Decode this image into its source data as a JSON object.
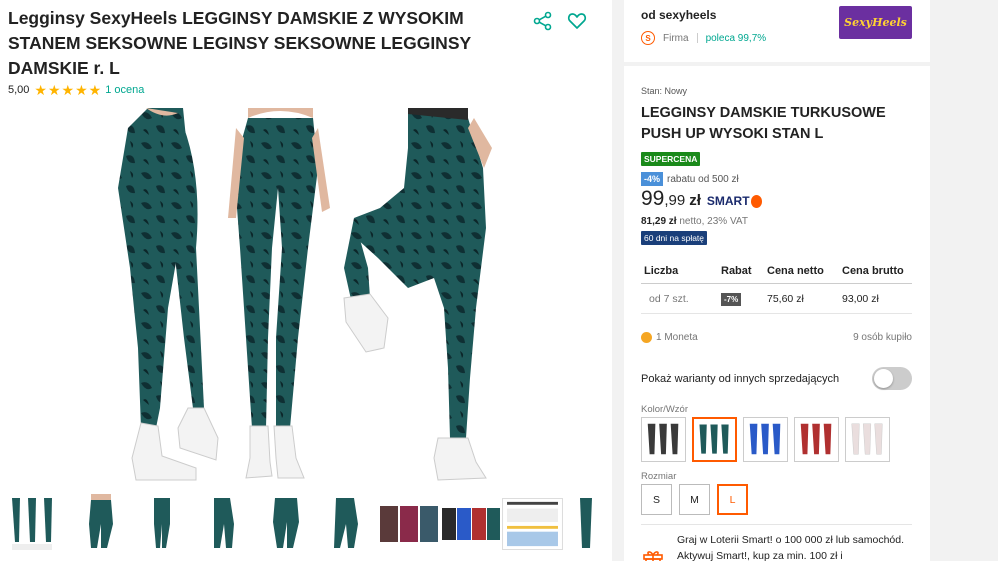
{
  "product": {
    "title": "Legginsy SexyHeels LEGGINSY DAMSKIE Z WYSOKIM STANEM SEKSOWNE LEGINSY SEKSOWNE LEGGINSY DAMSKIE r. L",
    "rating_value": "5,00",
    "rating_count": "1 ocena",
    "stars": 5
  },
  "icons": {
    "share": "share-icon",
    "favorite": "heart-icon"
  },
  "thumbnails": [
    {
      "name": "three-poses"
    },
    {
      "name": "back-view"
    },
    {
      "name": "front-view"
    },
    {
      "name": "side-view"
    },
    {
      "name": "back-pose"
    },
    {
      "name": "side-pose"
    },
    {
      "name": "color-grid"
    },
    {
      "name": "multi-color"
    },
    {
      "name": "size-chart"
    },
    {
      "name": "partial"
    }
  ],
  "seller": {
    "name": "od sexyheels",
    "type": "Firma",
    "recommend": "poleca 99,7%",
    "logo_text": "SexyHeels"
  },
  "offer": {
    "condition": "Stan: Nowy",
    "title": "LEGGINSY DAMSKIE TURKUSOWE PUSH UP WYSOKI STAN L",
    "super_badge": "SUPERCENA",
    "discount_pct": "-4%",
    "discount_text": "rabatu od 500 zł",
    "price_main": "99",
    "price_cents": ",99",
    "currency": "zł",
    "smart_label": "SMART",
    "netto_value": "81,29 zł",
    "netto_text": "netto, 23% VAT",
    "pay_later": "60 dni na spłatę"
  },
  "price_table": {
    "headers": [
      "Liczba",
      "Rabat",
      "Cena netto",
      "Cena brutto"
    ],
    "rows": [
      {
        "qty": "od 7 szt.",
        "rabat": "-7%",
        "netto": "75,60 zł",
        "brutto": "93,00 zł"
      }
    ]
  },
  "coins": {
    "label": "1 Moneta",
    "bought": "9 osób kupiło"
  },
  "other_sellers": {
    "label": "Pokaż warianty od innych sprzedających",
    "enabled": false
  },
  "variants": {
    "label": "Kolor/Wzór",
    "items": [
      {
        "color": "#3a3a3a",
        "selected": false
      },
      {
        "color": "#1f5a5a",
        "selected": true
      },
      {
        "color": "#2a5ac8",
        "selected": false
      },
      {
        "color": "#b03030",
        "selected": false
      },
      {
        "color": "#f0e6e6",
        "selected": false
      }
    ]
  },
  "sizes": {
    "label": "Rozmiar",
    "items": [
      {
        "label": "S",
        "selected": false
      },
      {
        "label": "M",
        "selected": false
      },
      {
        "label": "L",
        "selected": true
      }
    ]
  },
  "lottery": {
    "text": "Graj w Loterii Smart! o 100 000 zł lub samochód. Aktywuj Smart!, kup za min. 100 zł i"
  },
  "colors": {
    "accent": "#ff5a00",
    "teal": "#00a790",
    "legging": "#1f5a5a",
    "legging_dark": "#0f2f33"
  }
}
